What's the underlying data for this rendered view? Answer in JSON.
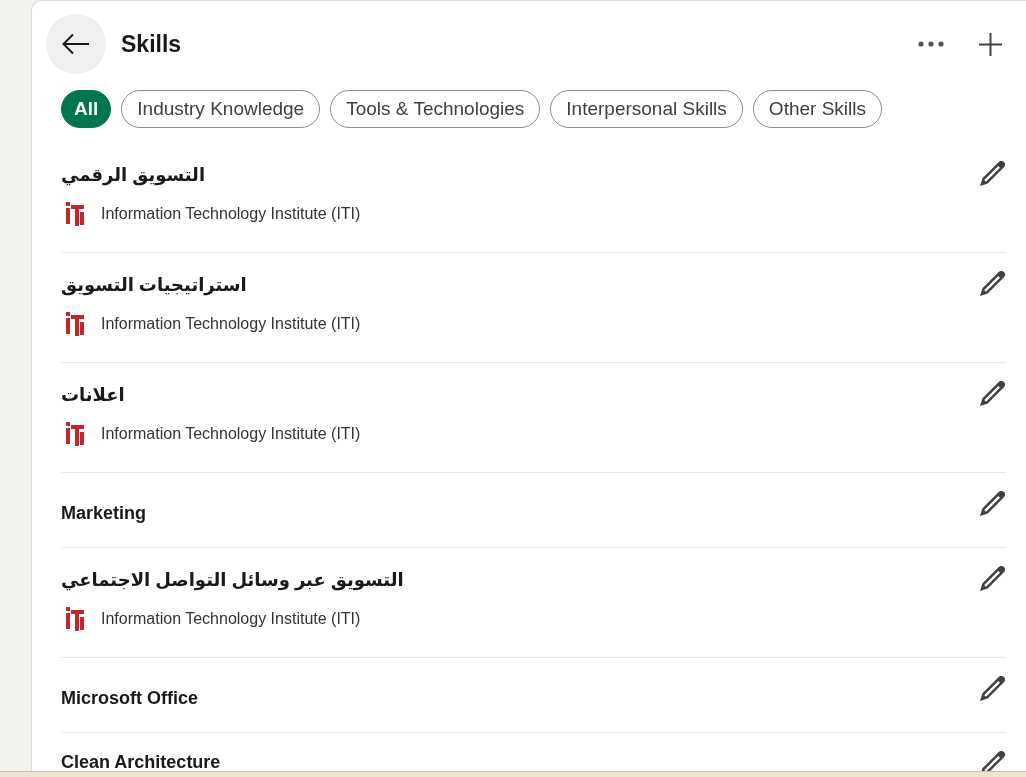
{
  "header": {
    "title": "Skills"
  },
  "filters": [
    {
      "label": "All",
      "selected": true
    },
    {
      "label": "Industry Knowledge",
      "selected": false
    },
    {
      "label": "Tools & Technologies",
      "selected": false
    },
    {
      "label": "Interpersonal Skills",
      "selected": false
    },
    {
      "label": "Other Skills",
      "selected": false
    }
  ],
  "skills": [
    {
      "name": "التسويق الرقمي",
      "source": "Information Technology Institute (ITI)"
    },
    {
      "name": "استراتيجيات التسويق",
      "source": "Information Technology Institute (ITI)"
    },
    {
      "name": "اعلانات",
      "source": "Information Technology Institute (ITI)"
    },
    {
      "name": "Marketing"
    },
    {
      "name": "التسويق عبر وسائل التواصل الاجتماعي",
      "source": "Information Technology Institute (ITI)"
    },
    {
      "name": "Microsoft Office"
    },
    {
      "name": "Clean Architecture"
    }
  ]
}
